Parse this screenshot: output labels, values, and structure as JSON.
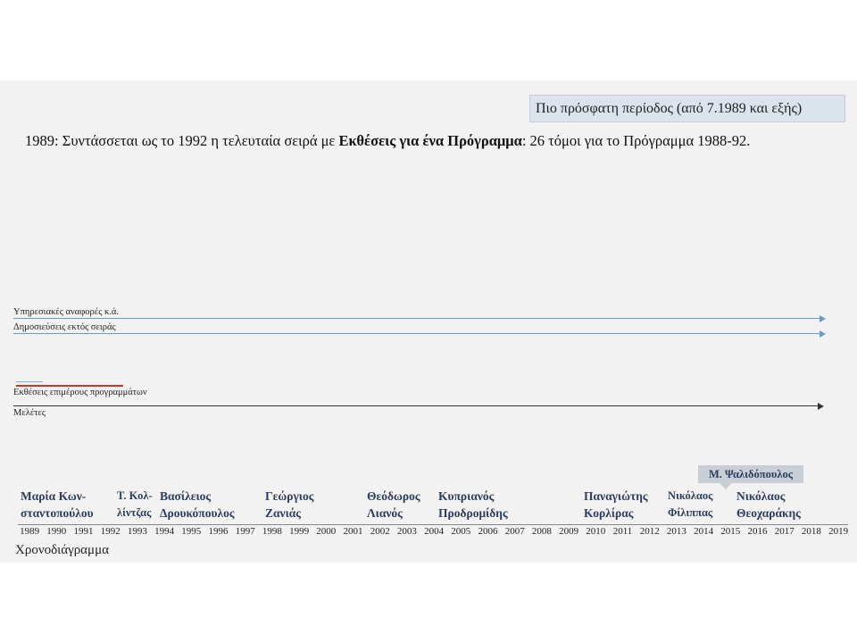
{
  "header": {
    "period_label": "Πιο πρόσφατη περίοδος (από 7.1989 και εξής)",
    "headline_pre": "1989: Συντάσσεται ως το 1992 η τελευταία σειρά με ",
    "headline_bold": "Εκθέσεις για ένα Πρόγραμμα",
    "headline_post": ": 26 τόμοι για το Πρόγραμμα 1988-92."
  },
  "tracks": [
    {
      "label": "Υπηρεσιακές αναφορές κ.ά."
    },
    {
      "label": "Δημοσιεύσεις εκτός σειράς"
    },
    {
      "label": "Εκθέσεις επιμέρους προγραμμάτων"
    },
    {
      "label": "Μελέτες"
    }
  ],
  "people": [
    {
      "line1": "Μαρία Κων-",
      "line2": "σταντοπούλου"
    },
    {
      "line1": "Τ. Κολ-",
      "line2": "λίντζας"
    },
    {
      "line1": "Βασίλειος",
      "line2": "Δρουκόπουλος"
    },
    {
      "line1": "Γεώργιος",
      "line2": "Ζανιάς"
    },
    {
      "line1": "Θεόδωρος",
      "line2": "Λιανός"
    },
    {
      "line1": "Κυπριανός",
      "line2": "Προδρομίδης"
    },
    {
      "line1": "Παναγιώτης",
      "line2": "Κορλίρας"
    },
    {
      "line1": "Νικόλαος",
      "line2": "Φίλιππας"
    },
    {
      "line1": "Νικόλαος",
      "line2": "Θεοχαράκης"
    }
  ],
  "highlight": {
    "label": "Μ. Ψαλιδόπουλος"
  },
  "timeline": {
    "title": "Χρονοδιάγραμμα",
    "years": [
      "1989",
      "1990",
      "1991",
      "1992",
      "1993",
      "1994",
      "1995",
      "1996",
      "1997",
      "1998",
      "1999",
      "2000",
      "2001",
      "2002",
      "2003",
      "2004",
      "2005",
      "2006",
      "2007",
      "2008",
      "2009",
      "2010",
      "2011",
      "2012",
      "2013",
      "2014",
      "2015",
      "2016",
      "2017",
      "2018",
      "2019"
    ]
  },
  "colors": {
    "arrow_blue": "#6b9ac4",
    "arrow_dark": "#333333",
    "segment_red": "#c0392b",
    "segment_teal": "#7fb3c8",
    "person_text": "#2b3e5c"
  }
}
